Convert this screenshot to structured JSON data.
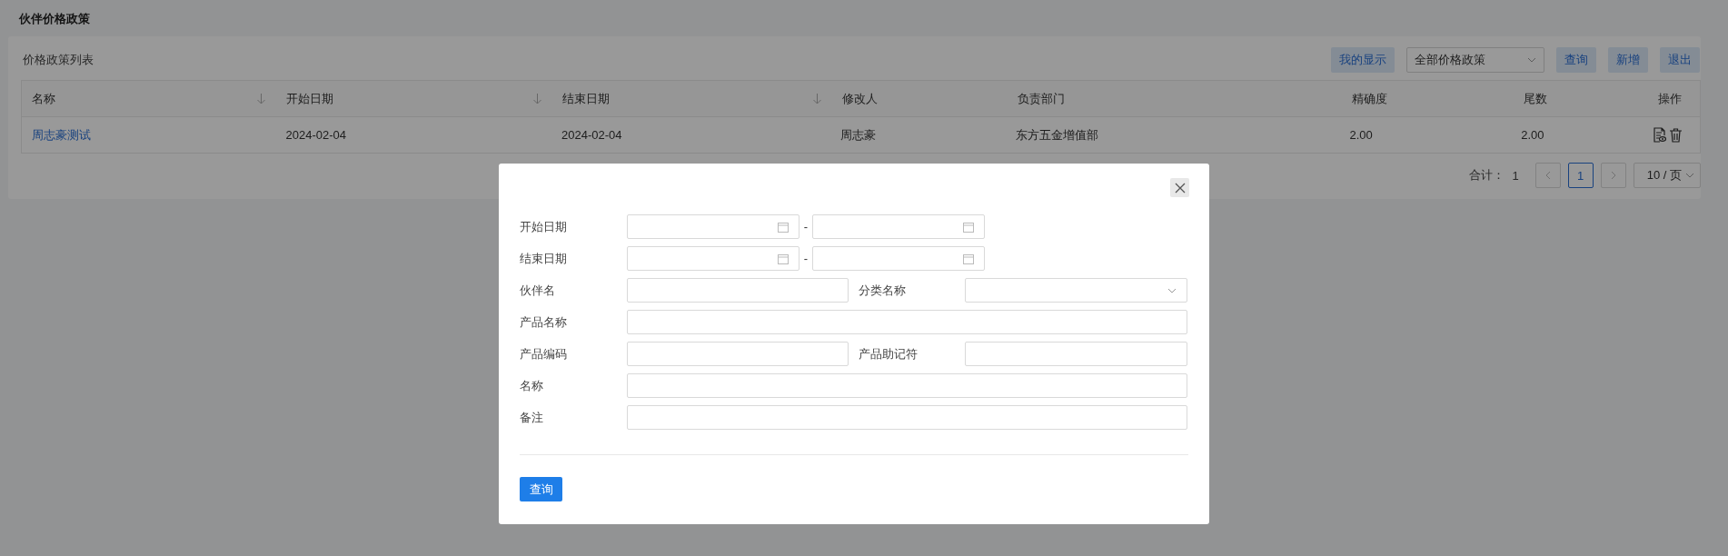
{
  "page_title": "伙伴价格政策",
  "panel": {
    "title": "价格政策列表",
    "toolbar": [
      {
        "kind": "button",
        "label": "我的显示"
      },
      {
        "kind": "select",
        "value": "全部价格政策"
      },
      {
        "kind": "button",
        "label": "查询"
      },
      {
        "kind": "button",
        "label": "新增"
      },
      {
        "kind": "button",
        "label": "退出"
      }
    ]
  },
  "table": {
    "columns": [
      {
        "label": "名称",
        "sortable": true,
        "kind": "link"
      },
      {
        "label": "开始日期",
        "sortable": true,
        "kind": "text"
      },
      {
        "label": "结束日期",
        "sortable": true,
        "kind": "text"
      },
      {
        "label": "修改人",
        "sortable": false,
        "kind": "text"
      },
      {
        "label": "负责部门",
        "sortable": false,
        "kind": "text"
      },
      {
        "label": "精确度",
        "sortable": false,
        "kind": "text"
      },
      {
        "label": "尾数",
        "sortable": false,
        "kind": "text"
      },
      {
        "label": "操作",
        "sortable": false,
        "kind": "actions"
      }
    ],
    "rows": [
      {
        "cells": [
          "周志豪测试",
          "2024-02-04",
          "2024-02-04",
          "周志豪",
          "东方五金增值部",
          "2.00",
          "2.00",
          ""
        ]
      }
    ]
  },
  "pagination": {
    "total_label": "合计：",
    "total": "1",
    "pages": [
      {
        "label": "1",
        "selected": true
      }
    ],
    "page_size": "10 / 页"
  },
  "dialog": {
    "rows": [
      {
        "fields": [
          {
            "label": "开始日期",
            "kind": "date-range",
            "separator": "-"
          }
        ]
      },
      {
        "fields": [
          {
            "label": "结束日期",
            "kind": "date-range",
            "separator": "-"
          }
        ]
      },
      {
        "fields": [
          {
            "label": "伙伴名",
            "kind": "text"
          },
          {
            "label": "分类名称",
            "kind": "select"
          }
        ]
      },
      {
        "fields": [
          {
            "label": "产品名称",
            "kind": "text"
          }
        ]
      },
      {
        "fields": [
          {
            "label": "产品编码",
            "kind": "text"
          },
          {
            "label": "产品助记符",
            "kind": "text"
          }
        ]
      },
      {
        "fields": [
          {
            "label": "名称",
            "kind": "text"
          }
        ]
      },
      {
        "fields": [
          {
            "label": "备注",
            "kind": "text"
          }
        ]
      }
    ],
    "submit": "查询"
  }
}
